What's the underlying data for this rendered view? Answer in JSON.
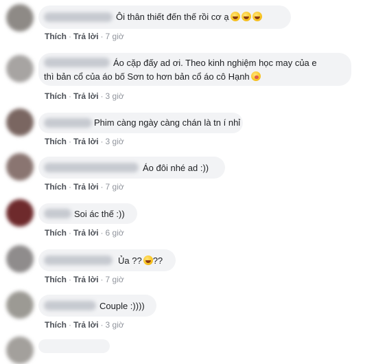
{
  "actions": {
    "like": "Thích",
    "reply": "Trả lời",
    "sep": "·"
  },
  "comments": [
    {
      "text": "Ôi thân thiết đến thế rồi cơ ạ",
      "emoji": [
        "laughing-crying-emoji",
        "laughing-crying-emoji",
        "laughing-crying-emoji"
      ],
      "time": "7 giờ"
    },
    {
      "lines": [
        "Áo cặp đấy ad ơi. Theo kinh nghiệm học may của e",
        "thì bản cổ của áo bố Sơn to hơn bản cổ áo cô Hạnh"
      ],
      "emoji": [
        "yum-emoji"
      ],
      "time": "3 giờ"
    },
    {
      "text": "Phim càng ngày càng chán là tn í nhỉ",
      "time": "3 giờ"
    },
    {
      "text": "Áo đôi nhé ad :))",
      "time": "7 giờ"
    },
    {
      "text": "Soi ác thế :))",
      "time": "6 giờ"
    },
    {
      "text_before": "Ủa ??",
      "text_after": "??",
      "emoji": [
        "grinning-emoji"
      ],
      "time": "7 giờ"
    },
    {
      "text": "Couple :))))",
      "time": "3 giờ"
    }
  ]
}
